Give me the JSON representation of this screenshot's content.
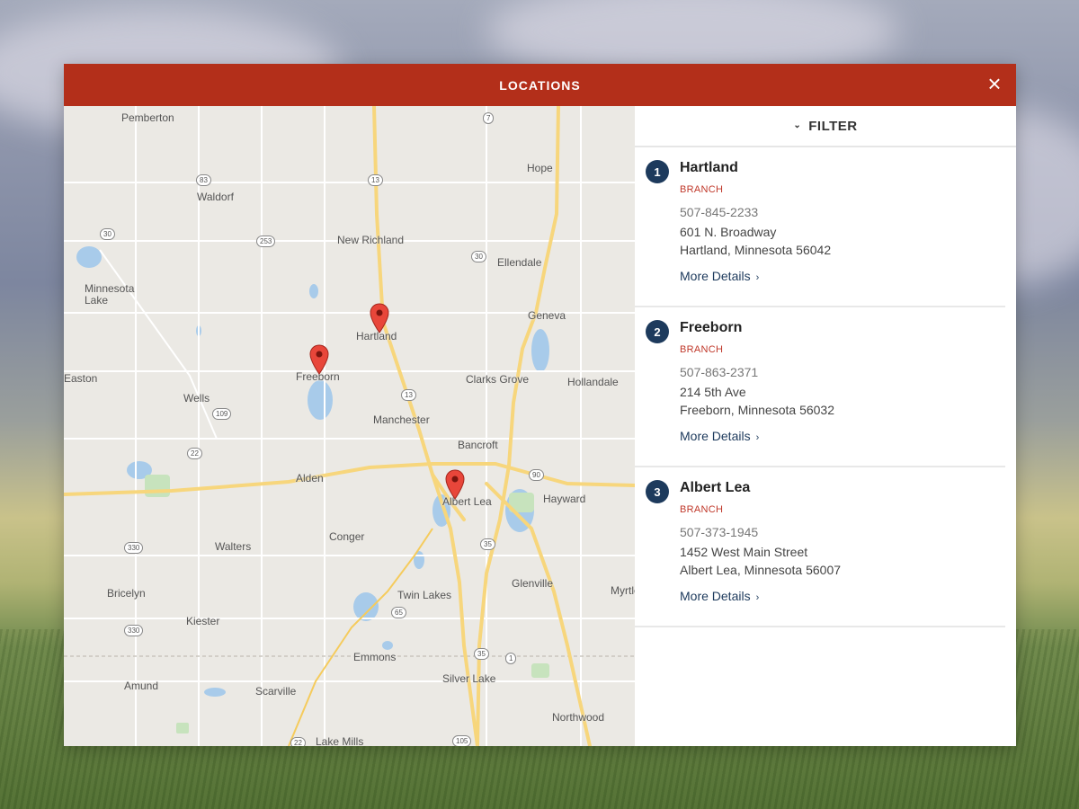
{
  "modal": {
    "title": "LOCATIONS",
    "close_icon": "close-icon",
    "accent_color": "#b32f1a",
    "brand_color": "#1d3a5c"
  },
  "filter": {
    "label": "FILTER",
    "icon": "chevron-down-icon"
  },
  "locations": [
    {
      "number": "1",
      "name": "Hartland",
      "type": "BRANCH",
      "phone": "507-845-2233",
      "address_line1": "601 N. Broadway",
      "address_line2": "Hartland, Minnesota 56042",
      "details_label": "More Details"
    },
    {
      "number": "2",
      "name": "Freeborn",
      "type": "BRANCH",
      "phone": "507-863-2371",
      "address_line1": "214 5th Ave",
      "address_line2": "Freeborn, Minnesota 56032",
      "details_label": "More Details"
    },
    {
      "number": "3",
      "name": "Albert Lea",
      "type": "BRANCH",
      "phone": "507-373-1945",
      "address_line1": "1452 West Main Street",
      "address_line2": "Albert Lea, Minnesota 56007",
      "details_label": "More Details"
    }
  ],
  "map": {
    "towns": [
      "Pemberton",
      "Hope",
      "Waldorf",
      "New Richland",
      "Ellendale",
      "Minnesota Lake",
      "Geneva",
      "Hartland",
      "Freeborn",
      "Clarks Grove",
      "Hollandale",
      "Wells",
      "Manchester",
      "Bancroft",
      "Alden",
      "Albert Lea",
      "Hayward",
      "Conger",
      "Walters",
      "Glenville",
      "Bricelyn",
      "Twin Lakes",
      "Myrtle",
      "Kiester",
      "Emmons",
      "Amund",
      "Scarville",
      "Silver Lake",
      "Northwood",
      "Lake Mills",
      "Easton"
    ],
    "route_shields": [
      "7",
      "83",
      "13",
      "30",
      "253",
      "30",
      "13",
      "109",
      "22",
      "90",
      "35",
      "330",
      "65",
      "330",
      "35",
      "1",
      "105",
      "22"
    ]
  }
}
